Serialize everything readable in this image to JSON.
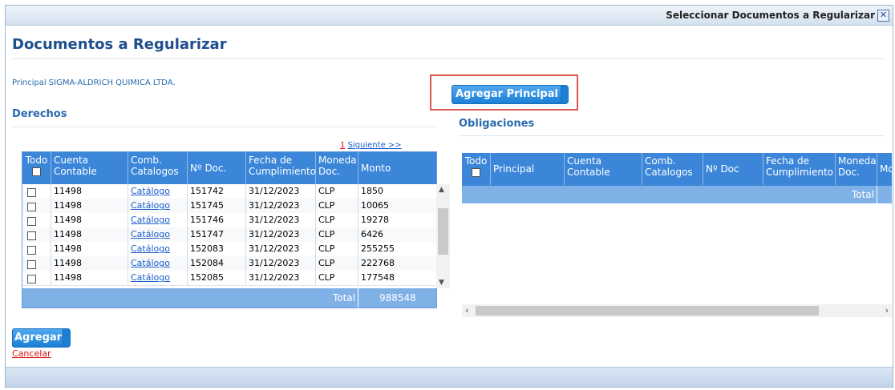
{
  "window": {
    "title": "Seleccionar Documentos a Regularizar",
    "close_icon": "close-icon"
  },
  "page": {
    "title": "Documentos a Regularizar",
    "principal_text": "Principal SIGMA-ALDRICH QUIMICA LTDA."
  },
  "buttons": {
    "agregar_principal": "Agregar Principal",
    "agregar": "Agregar",
    "cancelar": "Cancelar"
  },
  "derechos": {
    "title": "Derechos",
    "pagination": {
      "page": "1",
      "next": "Siguiente >>"
    },
    "headers": [
      "Todo",
      "Cuenta Contable",
      "Comb. Catalogos",
      "Nº Doc.",
      "Fecha de Cumplimiento",
      "Moneda Doc.",
      "Monto"
    ],
    "rows": [
      {
        "cuenta": "11498",
        "catalogo": "Catálogo",
        "doc": "151742",
        "fecha": "31/12/2023",
        "moneda": "CLP",
        "monto": "1850"
      },
      {
        "cuenta": "11498",
        "catalogo": "Catálogo",
        "doc": "151745",
        "fecha": "31/12/2023",
        "moneda": "CLP",
        "monto": "10065"
      },
      {
        "cuenta": "11498",
        "catalogo": "Catálogo",
        "doc": "151746",
        "fecha": "31/12/2023",
        "moneda": "CLP",
        "monto": "19278"
      },
      {
        "cuenta": "11498",
        "catalogo": "Catálogo",
        "doc": "151747",
        "fecha": "31/12/2023",
        "moneda": "CLP",
        "monto": "6426"
      },
      {
        "cuenta": "11498",
        "catalogo": "Catálogo",
        "doc": "152083",
        "fecha": "31/12/2023",
        "moneda": "CLP",
        "monto": "255255"
      },
      {
        "cuenta": "11498",
        "catalogo": "Catálogo",
        "doc": "152084",
        "fecha": "31/12/2023",
        "moneda": "CLP",
        "monto": "222768"
      },
      {
        "cuenta": "11498",
        "catalogo": "Catálogo",
        "doc": "152085",
        "fecha": "31/12/2023",
        "moneda": "CLP",
        "monto": "177548"
      }
    ],
    "total_label": "Total",
    "total_value": "988548"
  },
  "obligaciones": {
    "title": "Obligaciones",
    "headers": [
      "Todo",
      "Principal",
      "Cuenta Contable",
      "Comb. Catalogos",
      "Nº Doc",
      "Fecha de Cumplimiento",
      "Moneda Doc.",
      "Mo"
    ],
    "total_label": "Total"
  }
}
